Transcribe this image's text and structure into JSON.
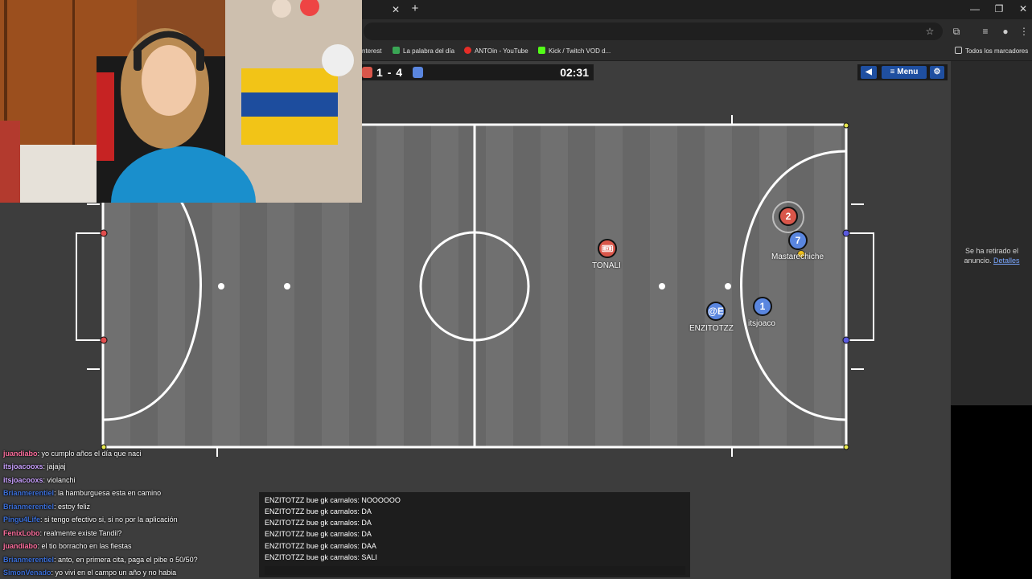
{
  "browser": {
    "tab_close_icon": "close-icon",
    "new_tab_symbol": "+",
    "window_controls": [
      "—",
      "❐",
      "✕"
    ],
    "bookmarks": [
      {
        "label": "nterest",
        "color": ""
      },
      {
        "label": "La palabra del día",
        "color": "#3aa655"
      },
      {
        "label": "ANTOin - YouTube",
        "color": "#e52d27"
      },
      {
        "label": "Kick / Twitch VOD d...",
        "color": "#53fc18"
      }
    ],
    "bookmarks_folder": "Todos los marcadores"
  },
  "game": {
    "score_left": "1",
    "score_sep": "-",
    "score_right": "4",
    "time": "02:31",
    "team_left_color": "#d9564a",
    "team_right_color": "#5a86df",
    "menu_label": "Menu",
    "players": [
      {
        "label": "🎟",
        "name": "TONALI",
        "team": "red"
      },
      {
        "label": "2",
        "name": "",
        "team": "red"
      },
      {
        "label": "7",
        "name": "Mastarechiche",
        "team": "blue"
      },
      {
        "label": "@E",
        "name": "ENZITOTZZ",
        "team": "blue"
      },
      {
        "label": "1",
        "name": "itsjoaco",
        "team": "blue"
      }
    ]
  },
  "ad": {
    "text": "Se ha retirado el anuncio.",
    "link": "Detalles"
  },
  "stream_chat": [
    {
      "user": "juandiabo",
      "color": "#ff6f9f",
      "msg": ": yo cumplo años el día que naci"
    },
    {
      "user": "itsjoacooxs",
      "color": "#c9a0ff",
      "msg": ": jajajaj"
    },
    {
      "user": "itsjoacooxs",
      "color": "#c9a0ff",
      "msg": ": violanchi"
    },
    {
      "user": "Brianmerentiel",
      "color": "#3b6fd9",
      "msg": ": la hamburguesa esta en camino"
    },
    {
      "user": "Brianmerentiel",
      "color": "#3b6fd9",
      "msg": ": estoy feliz"
    },
    {
      "user": "Pingu4Life",
      "color": "#3b6fd9",
      "msg": ": si tengo efectivo si, si no por la aplicación"
    },
    {
      "user": "FenixLobo",
      "color": "#ff6f9f",
      "msg": ": realmente existe Tandil?"
    },
    {
      "user": "juandiabo",
      "color": "#ff6f9f",
      "msg": ": el tio borracho en las fiestas"
    },
    {
      "user": "Brianmerentiel",
      "color": "#3b6fd9",
      "msg": ": anto, en primera cita, paga el pibe o 50/50?"
    },
    {
      "user": "SimonVenado",
      "color": "#3b6fd9",
      "msg": ": yo vivi en el campo un año y no habia"
    }
  ],
  "game_chat": [
    "ENZITOTZZ bue gk carnalos: NOOOOOO",
    "ENZITOTZZ bue gk carnalos: DA",
    "ENZITOTZZ bue gk carnalos: DA",
    "ENZITOTZZ bue gk carnalos: DA",
    "ENZITOTZZ bue gk carnalos: DAA",
    "ENZITOTZZ bue gk carnalos: SALI"
  ]
}
